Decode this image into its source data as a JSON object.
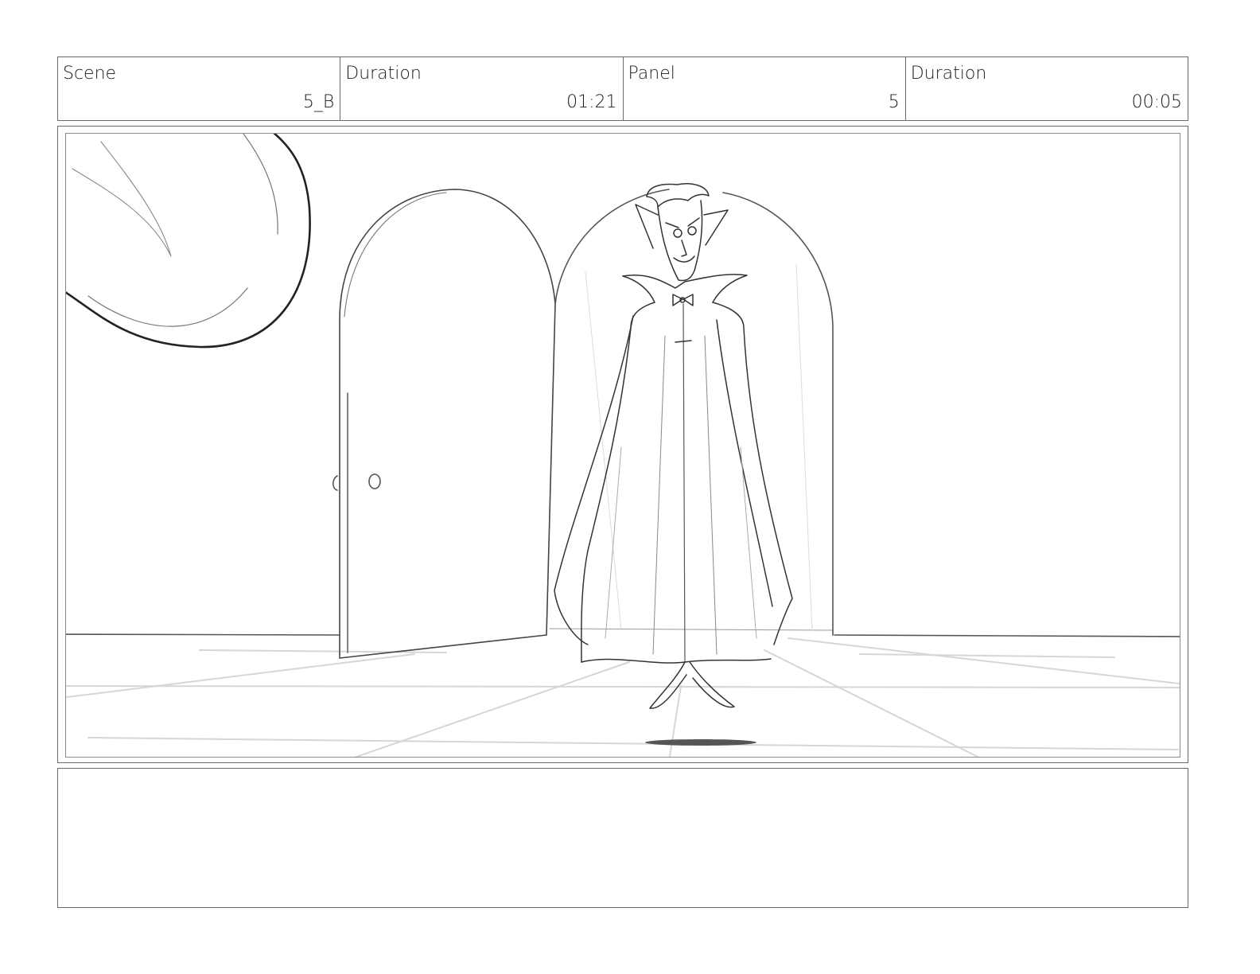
{
  "header": {
    "scene_label": "Scene",
    "scene_value": "5_B",
    "scene_duration_label": "Duration",
    "scene_duration_value": "01:21",
    "panel_label": "Panel",
    "panel_value": "5",
    "panel_duration_label": "Duration",
    "panel_duration_value": "00:05"
  },
  "frame": {
    "subject": "vampire-sketch",
    "props": [
      "moon-icon",
      "door-icon",
      "archway-icon",
      "shadow-icon"
    ]
  },
  "notes": {
    "text": ""
  }
}
